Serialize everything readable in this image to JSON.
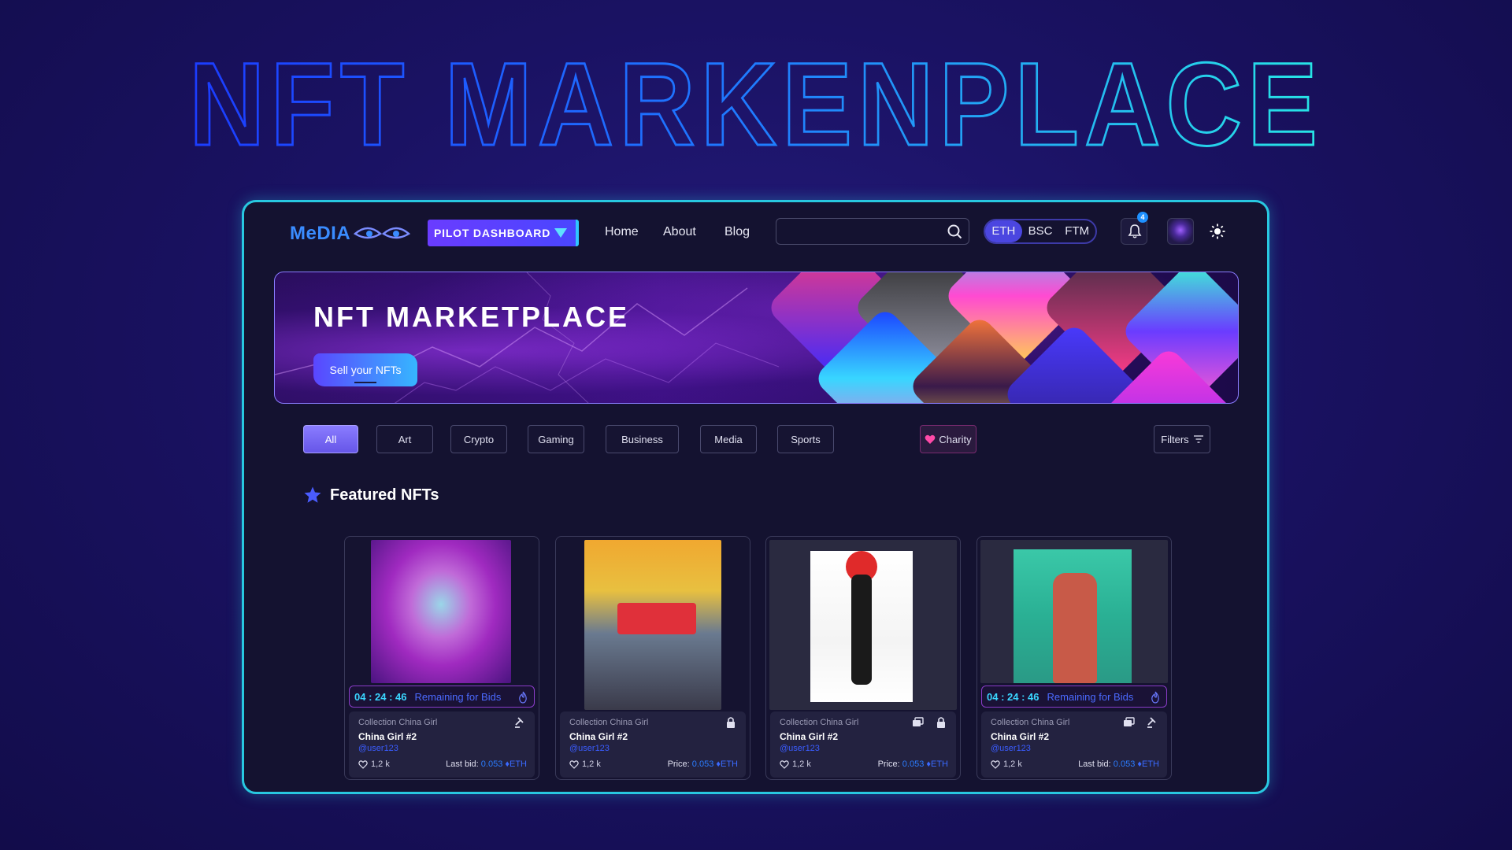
{
  "headline": "NFT MARKENPLACE",
  "nav": {
    "logo": "MeDIA",
    "pilot_label": "PILOT DASHBOARD",
    "links": [
      "Home",
      "About",
      "Blog"
    ],
    "search": {
      "value": "",
      "placeholder": ""
    },
    "chains": [
      "ETH",
      "BSC",
      "FTM"
    ],
    "active_chain": "ETH",
    "notification_count": "4"
  },
  "banner": {
    "title": "NFT MARKETPLACE",
    "cta": "Sell your NFTs"
  },
  "categories": [
    "All",
    "Art",
    "Crypto",
    "Gaming",
    "Business",
    "Media",
    "Sports"
  ],
  "active_category": "All",
  "charity_label": "Charity",
  "filters_label": "Filters",
  "featured_title": "Featured NFTs",
  "cards": [
    {
      "timer": "04 : 24 : 46",
      "timer_label": "Remaining for Bids",
      "collection": "Collection China Girl",
      "name": "China Girl #2",
      "user": "@user123",
      "likes": "1,2 k",
      "price_label": "Last bid:",
      "price": "0.053",
      "unit": "ETH"
    },
    {
      "collection": "Collection China Girl",
      "name": "China Girl #2",
      "user": "@user123",
      "likes": "1,2 k",
      "price_label": "Price:",
      "price": "0.053",
      "unit": "ETH"
    },
    {
      "collection": "Collection China Girl",
      "name": "China Girl #2",
      "user": "@user123",
      "likes": "1,2 k",
      "price_label": "Price:",
      "price": "0.053",
      "unit": "ETH"
    },
    {
      "timer": "04 : 24 : 46",
      "timer_label": "Remaining for Bids",
      "collection": "Collection China Girl",
      "name": "China Girl #2",
      "user": "@user123",
      "likes": "1,2 k",
      "price_label": "Last bid:",
      "price": "0.053",
      "unit": "ETH"
    }
  ],
  "colors": {
    "frame_border": "#28c8e0",
    "accent": "#4b46e0",
    "link_blue": "#2a7cff"
  }
}
